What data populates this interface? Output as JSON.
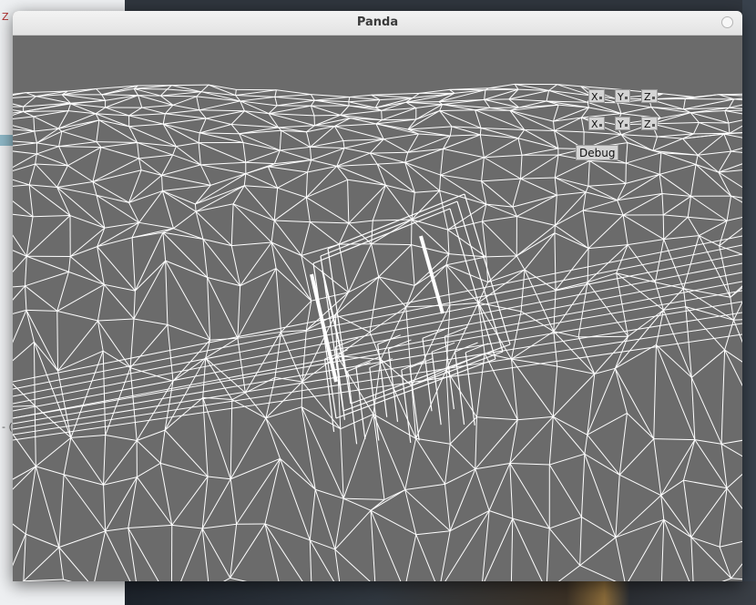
{
  "window": {
    "title": "Panda"
  },
  "background": {
    "left_text": "Z (",
    "left_dash": "- ("
  },
  "controls": {
    "row1": [
      {
        "label": "X"
      },
      {
        "label": "Y"
      },
      {
        "label": "Z"
      }
    ],
    "row2": [
      {
        "label": "X"
      },
      {
        "label": "Y"
      },
      {
        "label": "Z"
      }
    ],
    "debug_label": "Debug"
  },
  "colors": {
    "viewport_bg": "#6b6b6b",
    "wireframe": "#ffffff",
    "titlebar": "#e8e8e8"
  }
}
